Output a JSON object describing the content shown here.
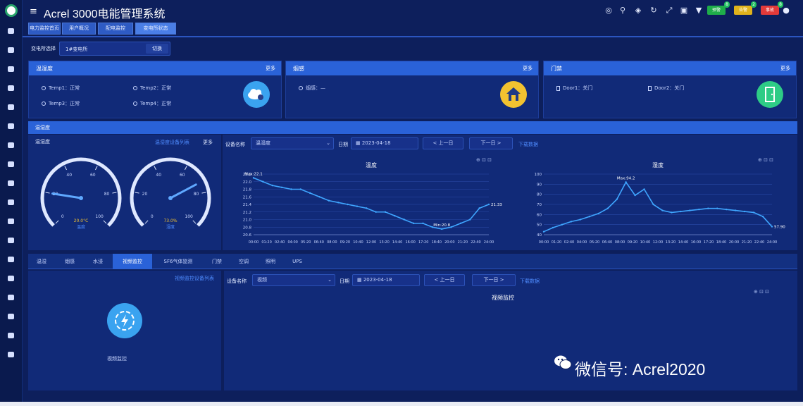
{
  "app": {
    "menu_glyph": "≡",
    "title": "Acrel 3000电能管理系统"
  },
  "header_badges": [
    {
      "label": "预警",
      "count": "8",
      "color": "#1fae4a"
    },
    {
      "label": "告警",
      "count": "2",
      "color": "#e0b21c"
    },
    {
      "label": "事故",
      "count": "8",
      "color": "#e23a3a"
    }
  ],
  "header_icons": [
    "palette-icon",
    "search-icon",
    "volume-icon",
    "refresh-icon",
    "fullscreen-icon",
    "window-icon",
    "shirt-icon"
  ],
  "nav_tabs": [
    "电力监控首页",
    "用户概况",
    "配电监控",
    "变电所状态"
  ],
  "substation": {
    "label": "变电所选择",
    "value": "1#变电所",
    "button": "切换"
  },
  "cards": {
    "temp": {
      "title": "温湿度",
      "more": "更多",
      "items": [
        "Temp1：正常",
        "Temp2：正常",
        "Temp3：正常",
        "Temp4：正常"
      ],
      "icon_color": "#3aa3f0"
    },
    "smoke": {
      "title": "烟感",
      "more": "更多",
      "items": [
        "烟感：—"
      ],
      "icon_color": "#f2c230"
    },
    "door": {
      "title": "门禁",
      "more": "更多",
      "items": [
        "Door1：关门",
        "Door2：关门"
      ],
      "icon_color": "#2ecc86"
    }
  },
  "monitor": {
    "section_title": "温湿度",
    "gauge_title": "温湿度",
    "gauge_link": "温湿度设备列表",
    "gauge_more": "更多",
    "gauges": [
      {
        "name": "温度",
        "value": "20.0°C",
        "unit": "温度",
        "min": 0,
        "max": 100,
        "reading": 20,
        "ticks": [
          "0",
          "20",
          "40",
          "60",
          "80",
          "100"
        ],
        "needle_color": "#5fa8ff"
      },
      {
        "name": "湿度",
        "value": "73.0%",
        "unit": "湿度",
        "min": 0,
        "max": 100,
        "reading": 73,
        "ticks": [
          "0",
          "20",
          "40",
          "60",
          "80",
          "100"
        ],
        "needle_color": "#5fa8ff"
      }
    ],
    "device_label": "设备名称",
    "device_value": "温湿度",
    "date_label": "日期",
    "date_value": "2023-04-18",
    "prev_day": "< 上一日",
    "next_day": "下一日 >",
    "export": "下载数据",
    "toolbar_glyphs": "⊕ ⊡ ⊡"
  },
  "lower_tabs": [
    "温湿",
    "烟感",
    "水浸",
    "视频监控",
    "SF6气体监测",
    "门禁",
    "空调",
    "照明",
    "UPS"
  ],
  "lower": {
    "left_link": "视频监控设备列表",
    "left_caption": "视频监控",
    "device_label": "设备名称",
    "device_value": "视频",
    "date_label": "日期",
    "date_value": "2023-04-18",
    "prev_day": "< 上一日",
    "next_day": "下一日 >",
    "export": "下载数据",
    "chart_title": "视频监控",
    "toolbar_glyphs": "⊕ ⊡ ⊡"
  },
  "watermark": {
    "text": "微信号: Acrel2020"
  },
  "chart_data": [
    {
      "type": "line",
      "title": "温度",
      "x": [
        "00:00",
        "01:20",
        "02:40",
        "04:00",
        "05:20",
        "06:40",
        "08:00",
        "09:20",
        "10:40",
        "12:00",
        "13:20",
        "14:40",
        "16:00",
        "17:20",
        "18:40",
        "20:00",
        "21:20",
        "22:40",
        "24:00"
      ],
      "x_ticks": [
        "00:00",
        "01:20",
        "02:40",
        "04:00",
        "05:20",
        "06:40",
        "08:00",
        "09:20",
        "10:40",
        "12:00",
        "13:20",
        "14:40",
        "16:00",
        "17:20",
        "18:40",
        "20:00",
        "21:20",
        "22:40",
        "24:00"
      ],
      "y_ticks": [
        "20.6",
        "20.8",
        "21.0",
        "21.2",
        "21.4",
        "21.6",
        "21.8",
        "22.0",
        "22.2"
      ],
      "ylim": [
        20.6,
        22.2
      ],
      "series": [
        {
          "color": "#3fa6ff",
          "values": [
            22.1,
            22.0,
            21.9,
            21.85,
            21.8,
            21.8,
            21.7,
            21.6,
            21.5,
            21.45,
            21.4,
            21.35,
            21.3,
            21.2,
            21.2,
            21.1,
            21.0,
            20.9,
            20.9,
            20.8,
            20.75,
            20.8,
            20.9,
            21.0,
            21.3,
            21.4
          ]
        }
      ],
      "max_label": "Max:22.1",
      "min_label": "Min:20.8",
      "last_label": "21.33"
    },
    {
      "type": "line",
      "title": "湿度",
      "x_ticks": [
        "00:00",
        "01:20",
        "02:40",
        "04:00",
        "05:20",
        "06:40",
        "08:00",
        "09:20",
        "10:40",
        "12:00",
        "13:20",
        "14:40",
        "16:00",
        "17:20",
        "18:40",
        "20:00",
        "21:20",
        "22:40",
        "24:00"
      ],
      "y_ticks": [
        "40",
        "50",
        "60",
        "70",
        "80",
        "90",
        "100"
      ],
      "ylim": [
        40,
        100
      ],
      "series": [
        {
          "color": "#3fa6ff",
          "values": [
            43,
            47,
            50,
            53,
            55,
            58,
            61,
            66,
            75,
            92,
            79,
            85,
            70,
            64,
            62,
            63,
            64,
            65,
            66,
            66,
            65,
            64,
            63,
            62,
            58,
            48
          ]
        }
      ],
      "max_label": "Max:94.2",
      "last_label": "57.90"
    }
  ]
}
